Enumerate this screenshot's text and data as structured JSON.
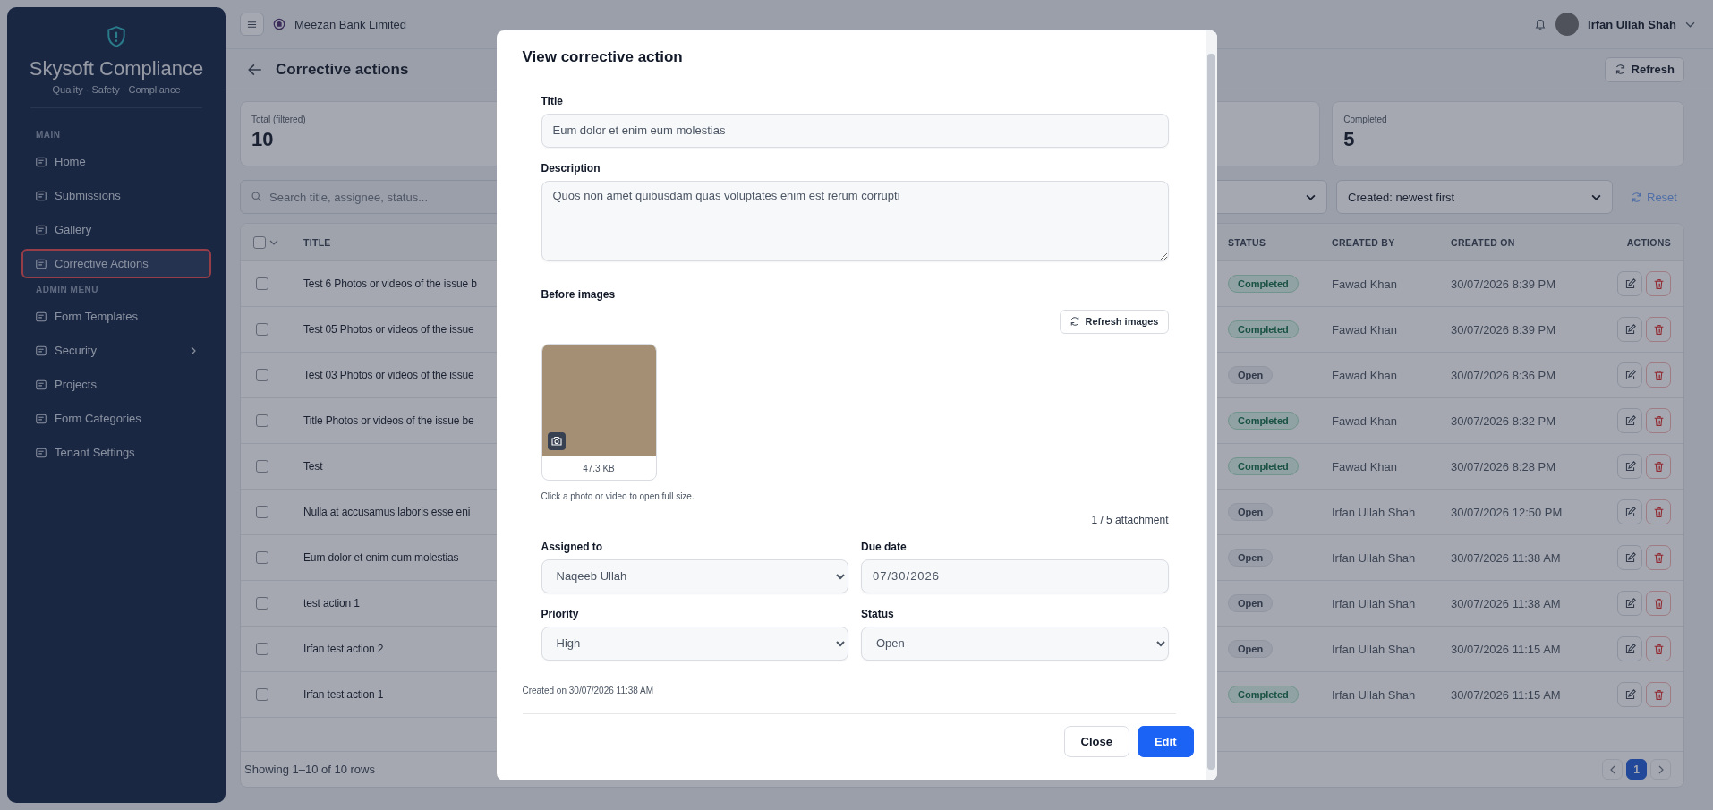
{
  "sidebar": {
    "brand": "Skysoft Compliance",
    "tagline": "Quality · Safety · Compliance",
    "sections": [
      {
        "heading": "MAIN",
        "items": [
          {
            "label": "Home",
            "selected": false,
            "has_submenu": false
          },
          {
            "label": "Submissions",
            "selected": false,
            "has_submenu": false
          },
          {
            "label": "Gallery",
            "selected": false,
            "has_submenu": false
          },
          {
            "label": "Corrective Actions",
            "selected": true,
            "has_submenu": false
          }
        ]
      },
      {
        "heading": "ADMIN MENU",
        "items": [
          {
            "label": "Form Templates",
            "selected": false,
            "has_submenu": false
          },
          {
            "label": "Security",
            "selected": false,
            "has_submenu": true
          },
          {
            "label": "Projects",
            "selected": false,
            "has_submenu": false
          },
          {
            "label": "Form Categories",
            "selected": false,
            "has_submenu": false
          },
          {
            "label": "Tenant Settings",
            "selected": false,
            "has_submenu": false
          }
        ]
      }
    ]
  },
  "header": {
    "organization": "Meezan Bank Limited",
    "user": "Irfan Ullah Shah"
  },
  "page": {
    "title": "Corrective actions",
    "refresh_button": "Refresh"
  },
  "stats": [
    {
      "label": "Total (filtered)",
      "value": "10"
    },
    {
      "label": "Completed",
      "value": "5"
    }
  ],
  "filters": {
    "search_placeholder": "Search title, assignee, status...",
    "sort": "Created: newest first",
    "reset": "Reset"
  },
  "table": {
    "all_checked": false,
    "columns": [
      "TITLE",
      "STATUS",
      "CREATED BY",
      "CREATED ON",
      "ACTIONS"
    ],
    "rows": [
      {
        "checked": false,
        "title": "Test 6 Photos or videos of the issue b",
        "status": "Completed",
        "kind": "completed",
        "created_by": "Fawad Khan",
        "created_on": "30/07/2026 8:39 PM"
      },
      {
        "checked": false,
        "title": "Test 05 Photos or videos of the issue",
        "status": "Completed",
        "kind": "completed",
        "created_by": "Fawad Khan",
        "created_on": "30/07/2026 8:39 PM"
      },
      {
        "checked": false,
        "title": "Test 03 Photos or videos of the issue",
        "status": "Open",
        "kind": "open",
        "created_by": "Fawad Khan",
        "created_on": "30/07/2026 8:36 PM"
      },
      {
        "checked": false,
        "title": "Title Photos or videos of the issue be",
        "status": "Completed",
        "kind": "completed",
        "created_by": "Fawad Khan",
        "created_on": "30/07/2026 8:32 PM"
      },
      {
        "checked": false,
        "title": "Test",
        "status": "Completed",
        "kind": "completed",
        "created_by": "Fawad Khan",
        "created_on": "30/07/2026 8:28 PM"
      },
      {
        "checked": false,
        "title": "Nulla at accusamus laboris esse eni",
        "status": "Open",
        "kind": "open",
        "created_by": "Irfan Ullah Shah",
        "created_on": "30/07/2026 12:50 PM"
      },
      {
        "checked": false,
        "title": "Eum dolor et enim eum molestias",
        "status": "Open",
        "kind": "open",
        "created_by": "Irfan Ullah Shah",
        "created_on": "30/07/2026 11:38 AM"
      },
      {
        "checked": false,
        "title": "test action 1",
        "status": "Open",
        "kind": "open",
        "created_by": "Irfan Ullah Shah",
        "created_on": "30/07/2026 11:38 AM"
      },
      {
        "checked": false,
        "title": "Irfan test action 2",
        "status": "Open",
        "kind": "open",
        "created_by": "Irfan Ullah Shah",
        "created_on": "30/07/2026 11:15 AM"
      },
      {
        "checked": false,
        "title": "Irfan test action 1",
        "status": "Completed",
        "kind": "completed",
        "created_by": "Irfan Ullah Shah",
        "created_on": "30/07/2026 11:15 AM"
      }
    ],
    "footer": "Showing 1–10 of 10 rows",
    "pages": [
      {
        "label": "1",
        "selected": true
      }
    ]
  },
  "modal": {
    "heading": "View corrective action",
    "title": {
      "label": "Title",
      "value": "Eum dolor et enim eum molestias"
    },
    "description": {
      "label": "Description",
      "value": "Quos non amet quibusdam quas voluptates enim est rerum corrupti"
    },
    "before_images": {
      "label": "Before images",
      "refresh_button": "Refresh images",
      "attachments": [
        {
          "size": "47.3 KB"
        }
      ],
      "hint": "Click a photo or video to open full size.",
      "count": "1 / 5 attachment"
    },
    "assigned_to": {
      "label": "Assigned to",
      "value": "Naqeeb Ullah"
    },
    "due_date": {
      "label": "Due date",
      "value": "07/30/2026"
    },
    "priority": {
      "label": "Priority",
      "value": "High"
    },
    "status": {
      "label": "Status",
      "value": "Open"
    },
    "created_note": "Created on 30/07/2026 11:38 AM",
    "buttons": [
      {
        "label": "Close",
        "kind": "secondary"
      },
      {
        "label": "Edit",
        "kind": "primary"
      }
    ]
  }
}
